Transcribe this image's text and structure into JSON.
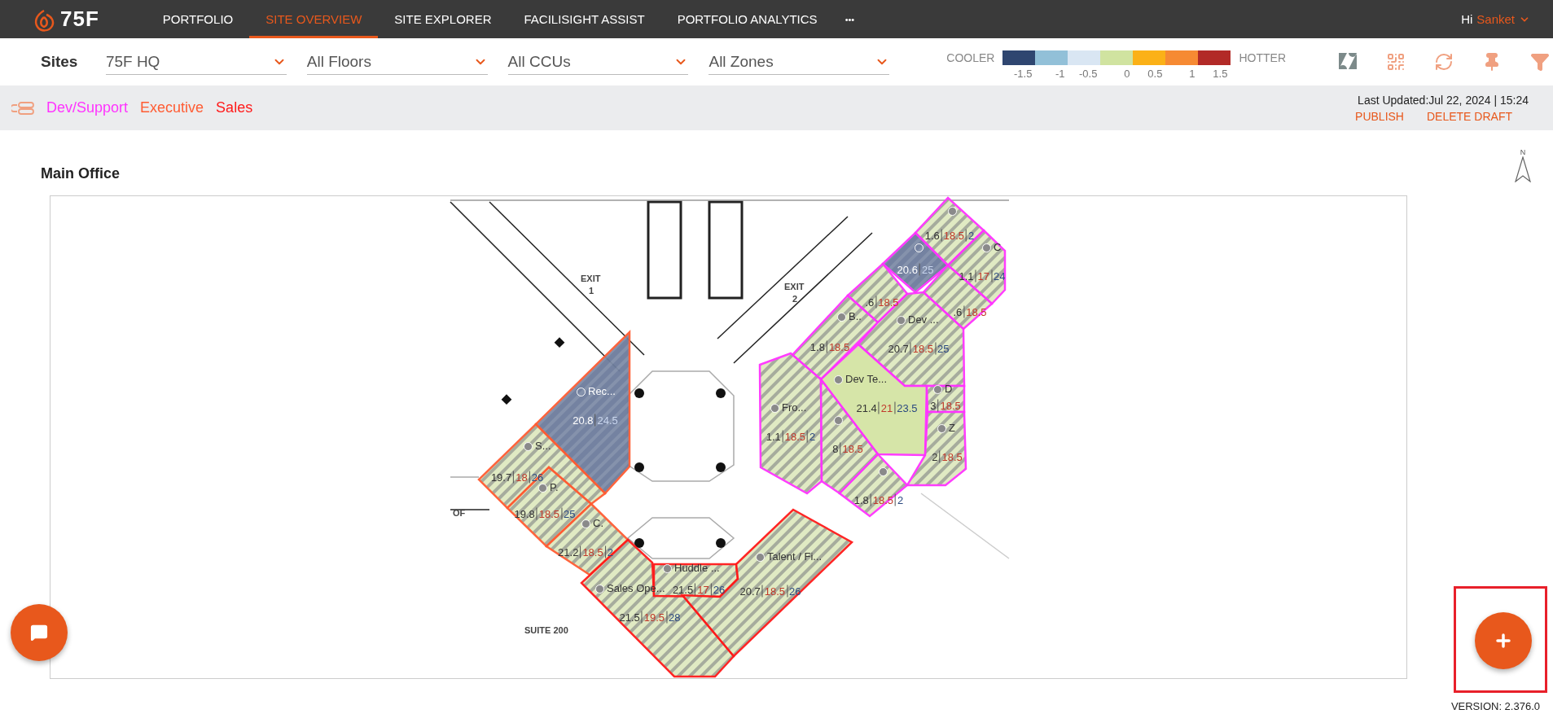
{
  "nav": {
    "brand": "75F",
    "items": [
      {
        "label": "PORTFOLIO",
        "selected": false
      },
      {
        "label": "SITE OVERVIEW",
        "selected": true
      },
      {
        "label": "SITE EXPLORER",
        "selected": false
      },
      {
        "label": "FACILISIGHT ASSIST",
        "selected": false
      },
      {
        "label": "PORTFOLIO ANALYTICS",
        "selected": false
      }
    ],
    "more": "•••",
    "greeting": "Hi",
    "user": "Sanket"
  },
  "filters": {
    "label": "Sites",
    "dropdowns": [
      "75F HQ",
      "All Floors",
      "All CCUs",
      "All Zones"
    ]
  },
  "legend": {
    "cooler": "COOLER",
    "hotter": "HOTTER",
    "steps": [
      {
        "color": "#2f4670",
        "label": "-1.5"
      },
      {
        "color": "#92c0d8",
        "label": "-1"
      },
      {
        "color": "#d9e6f3",
        "label": "-0.5"
      },
      {
        "color": "#d0e3a0",
        "label": "0"
      },
      {
        "color": "#fbb117",
        "label": "0.5"
      },
      {
        "color": "#f68a33",
        "label": "1"
      },
      {
        "color": "#b22a27",
        "label": "1.5"
      }
    ]
  },
  "groups": [
    {
      "name": "Dev/Support",
      "color": "#ff33ff"
    },
    {
      "name": "Executive",
      "color": "#ff5c33"
    },
    {
      "name": "Sales",
      "color": "#ff1a1a"
    }
  ],
  "last_updated": "Last Updated:Jul 22, 2024 | 15:24",
  "actions": [
    "PUBLISH",
    "DELETE DRAFT"
  ],
  "floor": {
    "title": "Main Office",
    "compass": "N",
    "plan_labels": [
      "EXIT",
      "1",
      "EXIT",
      "2",
      "OF",
      "SUITE 200"
    ],
    "zones": [
      {
        "kind": "stripe",
        "color": "#ff33ff",
        "dot": true,
        "readings": [
          {
            "text": "1.6",
            "kind": "current"
          },
          {
            "text": "18.5",
            "kind": "heat"
          },
          {
            "text": "2",
            "kind": "cool"
          }
        ]
      },
      {
        "kind": "cold",
        "color": "#ff33ff",
        "dot": true,
        "readings": [
          {
            "text": "20.6",
            "kind": "current"
          },
          {
            "text": "25",
            "kind": "cool"
          }
        ]
      },
      {
        "kind": "stripe",
        "color": "#ff33ff",
        "dot": true,
        "name": "C",
        "readings": [
          {
            "text": "1.1",
            "kind": "current"
          },
          {
            "text": "17",
            "kind": "heat"
          },
          {
            "text": "24",
            "kind": "cool"
          }
        ]
      },
      {
        "kind": "stripe",
        "color": "#ff33ff",
        "dot": false,
        "readings": [
          {
            "text": ".6",
            "kind": "current"
          },
          {
            "text": "18.5",
            "kind": "heat"
          }
        ]
      },
      {
        "kind": "stripe",
        "color": "#ff33ff",
        "dot": false,
        "readings": [
          {
            "text": ".6",
            "kind": "current"
          },
          {
            "text": "18.5",
            "kind": "heat"
          }
        ]
      },
      {
        "kind": "stripe",
        "color": "#ff33ff",
        "dot": true,
        "name": "B..",
        "readings": [
          {
            "text": "1.8",
            "kind": "current"
          },
          {
            "text": "18.5",
            "kind": "heat"
          }
        ]
      },
      {
        "kind": "stripe",
        "color": "#ff33ff",
        "dot": true,
        "name": "Dev ...",
        "readings": [
          {
            "text": "20.7",
            "kind": "current"
          },
          {
            "text": "18.5",
            "kind": "heat"
          },
          {
            "text": "25",
            "kind": "cool"
          }
        ]
      },
      {
        "kind": "solid",
        "color": "#ff33ff",
        "dot": true,
        "name": "Dev Te...",
        "readings": [
          {
            "text": "21.4",
            "kind": "current"
          },
          {
            "text": "21",
            "kind": "heat"
          },
          {
            "text": "23.5",
            "kind": "cool"
          }
        ]
      },
      {
        "kind": "stripe",
        "color": "#ff33ff",
        "dot": true,
        "name": "D",
        "readings": [
          {
            "text": "3",
            "kind": "current"
          },
          {
            "text": "18.5",
            "kind": "heat"
          }
        ]
      },
      {
        "kind": "stripe",
        "color": "#ff33ff",
        "dot": true,
        "name": "Fro...",
        "readings": [
          {
            "text": "1.1",
            "kind": "current"
          },
          {
            "text": "18.5",
            "kind": "heat"
          },
          {
            "text": "2",
            "kind": "cool"
          }
        ]
      },
      {
        "kind": "stripe",
        "color": "#ff33ff",
        "dot": true,
        "readings": [
          {
            "text": "8",
            "kind": "current"
          },
          {
            "text": "18.5",
            "kind": "heat"
          }
        ]
      },
      {
        "kind": "stripe",
        "color": "#ff33ff",
        "dot": true,
        "name": "Z",
        "readings": [
          {
            "text": "2",
            "kind": "current"
          },
          {
            "text": "18.5",
            "kind": "heat"
          }
        ]
      },
      {
        "kind": "stripe",
        "color": "#ff33ff",
        "dot": true,
        "readings": [
          {
            "text": "1.8",
            "kind": "current"
          },
          {
            "text": "18.5",
            "kind": "heat"
          },
          {
            "text": "2",
            "kind": "cool"
          }
        ]
      },
      {
        "kind": "cold",
        "color": "#ff5c33",
        "dot": true,
        "name": "Rec...",
        "readings": [
          {
            "text": "20.8",
            "kind": "current"
          },
          {
            "text": "24.5",
            "kind": "cool"
          }
        ]
      },
      {
        "kind": "stripe",
        "color": "#ff5c33",
        "dot": true,
        "name": "S...",
        "readings": [
          {
            "text": "19.7",
            "kind": "current"
          },
          {
            "text": "18",
            "kind": "heat"
          },
          {
            "text": "26",
            "kind": "cool"
          }
        ]
      },
      {
        "kind": "stripe",
        "color": "#ff5c33",
        "dot": true,
        "name": "P.",
        "readings": [
          {
            "text": "19.8",
            "kind": "current"
          },
          {
            "text": "18.5",
            "kind": "heat"
          },
          {
            "text": "25",
            "kind": "cool"
          }
        ]
      },
      {
        "kind": "stripe",
        "color": "#ff5c33",
        "dot": true,
        "name": "C.",
        "readings": [
          {
            "text": "21.2",
            "kind": "current"
          },
          {
            "text": "18.5",
            "kind": "heat"
          },
          {
            "text": "2",
            "kind": "cool"
          }
        ]
      },
      {
        "kind": "stripe",
        "color": "#ff1a1a",
        "dot": true,
        "name": "Sales Ope...",
        "readings": [
          {
            "text": "21.5",
            "kind": "current"
          },
          {
            "text": "19.5",
            "kind": "heat"
          },
          {
            "text": "28",
            "kind": "cool"
          }
        ]
      },
      {
        "kind": "stripe",
        "color": "#ff1a1a",
        "dot": true,
        "name": "Huddle ...",
        "readings": [
          {
            "text": "21.5",
            "kind": "current"
          },
          {
            "text": "17",
            "kind": "heat"
          },
          {
            "text": "26",
            "kind": "cool"
          }
        ]
      },
      {
        "kind": "stripe",
        "color": "#ff1a1a",
        "dot": true,
        "name": "Talent / Fi...",
        "readings": [
          {
            "text": "20.7",
            "kind": "current"
          },
          {
            "text": "18.5",
            "kind": "heat"
          },
          {
            "text": "26",
            "kind": "cool"
          }
        ]
      }
    ]
  },
  "version": "VERSION: 2.376.0"
}
